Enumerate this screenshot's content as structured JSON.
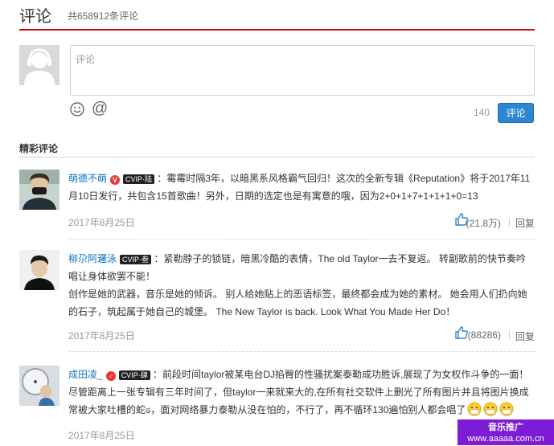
{
  "header": {
    "title": "评论",
    "count_text": "共658912条评论"
  },
  "composer": {
    "placeholder": "评论",
    "remaining": "140",
    "submit_label": "评论",
    "at_symbol": "@"
  },
  "section_title": "精彩评论",
  "comments": [
    {
      "user": "萌德不萌",
      "badge_v": "V",
      "vip": "CVIP·陆",
      "text": "：霉霉时隔3年，以暗黑系风格霸气回归！这次的全新专辑《Reputation》将于2017年11月10日发行，共包含15首歌曲！另外，日期的选定也是有寓意的哦，因为2+0+1+7+1+1+1+0=13",
      "date": "2017年8月25日",
      "likes": "(21.8万)",
      "reply": "回复",
      "sep": "|"
    },
    {
      "user": "柳尕阿邏泳",
      "vip": "CVIP·叁",
      "text": "：紧勒脖子的锁链，暗黑冷酷的表情，The old Taylor一去不复返。 转副歌前的快节奏吟唱让身体欲罢不能！",
      "text2": "创作是她的武器，音乐是她的倾诉。 别人给她贴上的恶语标签，最终都会成为她的素材。 她会用人们扔向她的石子，筑起属于她自己的城堡。 The New Taylor is back. Look What You Made Her Do！",
      "date": "2017年8月25日",
      "likes": "(88286)",
      "reply": "回复",
      "sep": "|"
    },
    {
      "user": "成田凌_",
      "badge_v": "♂",
      "vip": "CVIP·肆",
      "text": "：前段时间taylor被某电台DJ掐臀的性骚扰案泰勒成功胜诉,展现了为女权作斗争的一面！尽管距离上一张专辑有三年时间了，但taylor一来就来大的,在所有社交软件上删光了所有图片并且将图片换成常被大家吐槽的蛇ಠ，面对网络暴力泰勒从没在怕的，不行了，再不循环130遍怕别人都会唱了",
      "date": "2017年8月25日",
      "likes": "",
      "reply": "",
      "sep": ""
    }
  ],
  "watermark": {
    "line1": "音乐推广",
    "line2": "www.aaaaa.com.cn"
  },
  "colors": {
    "accent_red": "#c20c0c",
    "link_blue": "#0c73c2",
    "button_blue": "#2e86d2",
    "watermark_purple": "#7e1bd6"
  }
}
